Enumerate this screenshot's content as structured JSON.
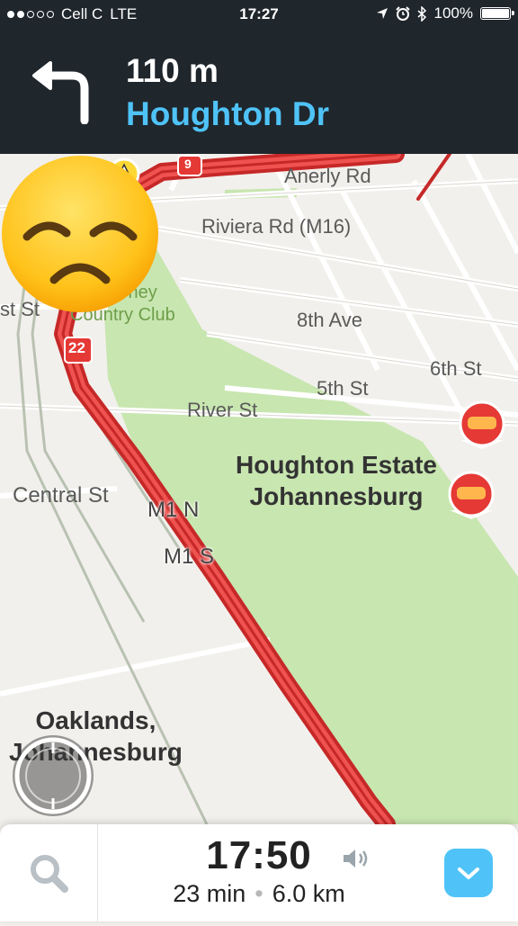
{
  "status_bar": {
    "signal_dots_filled": 2,
    "signal_dots_total": 5,
    "carrier": "Cell C",
    "network": "LTE",
    "time": "17:27",
    "battery": "100%",
    "battery_level": 1.0,
    "icons": [
      "location-arrow-icon",
      "alarm-icon",
      "bluetooth-icon",
      "battery-icon"
    ]
  },
  "navigation": {
    "distance": "110 m",
    "street": "Houghton Dr",
    "turn_icon": "turn-left-arrow-icon"
  },
  "map": {
    "labels": {
      "anerly_rd": "Anerly Rd",
      "riviera_rd": "Riviera Rd (M16)",
      "killarney": "Killarney\nCountry Club",
      "st_st": "st St",
      "eighth_ave": "8th Ave",
      "sixth_st": "6th St",
      "fifth_st": "5th St",
      "river_st": "River St",
      "houghton_estate": "Houghton Estate\nJohannesburg",
      "central_st": "Central St",
      "m1n": "M1 N",
      "m1s": "M1 S",
      "oaklands": "Oaklands,\nJohannesburg",
      "speed_22": "22",
      "speed_9": "9"
    },
    "markers": [
      "hazard-icon",
      "hazard-icon",
      "police-icon",
      "traffic-jam-icon",
      "traffic-jam-icon",
      "traffic-jam-icon"
    ],
    "emoji": "disappointed-face-icon"
  },
  "bottom_bar": {
    "eta": "17:50",
    "duration": "23 min",
    "distance": "6.0 km",
    "separator": "•"
  },
  "colors": {
    "header_bg": "#1f262c",
    "accent_blue": "#4fc3f7",
    "route_red": "#e53935",
    "park_green": "#c8e6b0"
  }
}
